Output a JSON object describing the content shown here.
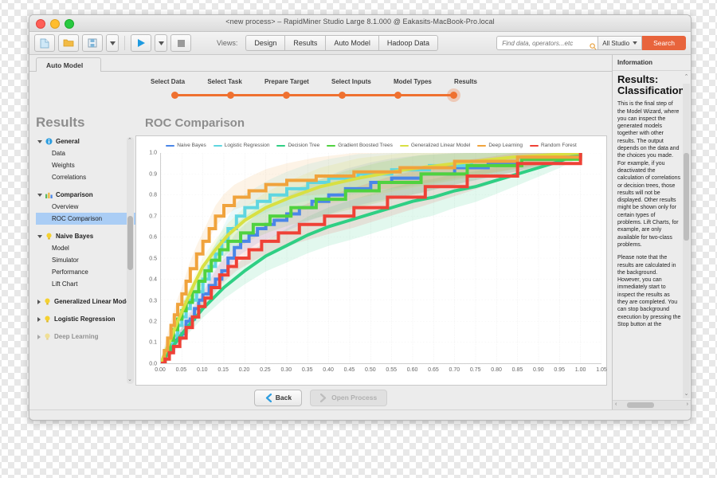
{
  "window": {
    "title": "<new process> – RapidMiner Studio Large 8.1.000 @ Eakasits-MacBook-Pro.local"
  },
  "toolbar": {
    "views_label": "Views:",
    "view_tabs": [
      "Design",
      "Results",
      "Auto Model",
      "Hadoop Data"
    ],
    "search_placeholder": "Find data, operators...etc",
    "search_value": "",
    "scope_selected": "All Studio",
    "search_button": "Search",
    "icons": [
      "new-process-icon",
      "open-folder-icon",
      "save-icon",
      "save-dropdown-icon",
      "run-icon",
      "run-dropdown-icon",
      "stop-icon",
      "search-icon"
    ]
  },
  "app_tab": {
    "label": "Auto Model"
  },
  "wizard": {
    "steps": [
      "Select Data",
      "Select Task",
      "Prepare Target",
      "Select Inputs",
      "Model Types",
      "Results"
    ],
    "active_index": 5,
    "accent": "#ef7130"
  },
  "sidebar": {
    "heading": "Results",
    "nodes": [
      {
        "label": "General",
        "icon": "info-icon",
        "expanded": true,
        "children": [
          "Data",
          "Weights",
          "Correlations"
        ]
      },
      {
        "label": "Comparison",
        "icon": "bars-icon",
        "expanded": true,
        "children": [
          "Overview",
          "ROC Comparison"
        ]
      },
      {
        "label": "Naive Bayes",
        "icon": "bulb-icon",
        "expanded": true,
        "children": [
          "Model",
          "Simulator",
          "Performance",
          "Lift Chart"
        ]
      },
      {
        "label": "Generalized Linear Model",
        "icon": "bulb-icon",
        "expanded": false,
        "children": []
      },
      {
        "label": "Logistic Regression",
        "icon": "bulb-icon",
        "expanded": false,
        "children": []
      },
      {
        "label": "Deep Learning",
        "icon": "bulb-icon",
        "expanded": false,
        "children": []
      }
    ],
    "selected": "ROC Comparison"
  },
  "main": {
    "panel_title": "ROC Comparison",
    "back_button": "Back",
    "open_process_button": "Open Process"
  },
  "info": {
    "header": "Information",
    "title": "Results: Classification",
    "paragraphs": [
      "This is the final step of the Model Wizard, where you can inspect the generated models together with other results. The output depends on the data and the choices you made. For example, if you deactivated the calculation of correlations or decision trees, those results will not be displayed. Other results might be shown only for certain types of problems. Lift Charts, for example, are only available for two-class problems.",
      "Please note that the results are calculated in the background. However, you can immediately start to inspect the results as they are completed. You can stop background execution by pressing the Stop button at the"
    ]
  },
  "chart_data": {
    "type": "line",
    "title": "ROC Comparison",
    "xlabel": "",
    "ylabel": "",
    "xlim": [
      0.0,
      1.05
    ],
    "ylim": [
      0.0,
      1.0
    ],
    "grid": true,
    "legend_position": "top-center",
    "xticks": [
      "0.00",
      "0.05",
      "0.10",
      "0.15",
      "0.20",
      "0.25",
      "0.30",
      "0.35",
      "0.40",
      "0.45",
      "0.50",
      "0.55",
      "0.60",
      "0.65",
      "0.70",
      "0.75",
      "0.80",
      "0.85",
      "0.90",
      "0.95",
      "1.00",
      "1.05"
    ],
    "yticks": [
      "0.0",
      "0.1",
      "0.2",
      "0.3",
      "0.4",
      "0.5",
      "0.6",
      "0.7",
      "0.8",
      "0.9",
      "1.0"
    ],
    "series": [
      {
        "name": "Naive Bayes",
        "color": "#4a86e8",
        "band_color": "rgba(74,134,232,0.13)",
        "points": [
          [
            0,
            0
          ],
          [
            0.01,
            0.04
          ],
          [
            0.02,
            0.06
          ],
          [
            0.03,
            0.11
          ],
          [
            0.04,
            0.12
          ],
          [
            0.05,
            0.14
          ],
          [
            0.06,
            0.2
          ],
          [
            0.07,
            0.21
          ],
          [
            0.08,
            0.26
          ],
          [
            0.09,
            0.3
          ],
          [
            0.1,
            0.33
          ],
          [
            0.115,
            0.37
          ],
          [
            0.13,
            0.4
          ],
          [
            0.145,
            0.44
          ],
          [
            0.16,
            0.5
          ],
          [
            0.175,
            0.55
          ],
          [
            0.19,
            0.58
          ],
          [
            0.21,
            0.61
          ],
          [
            0.23,
            0.64
          ],
          [
            0.25,
            0.66
          ],
          [
            0.27,
            0.68
          ],
          [
            0.3,
            0.71
          ],
          [
            0.33,
            0.74
          ],
          [
            0.36,
            0.77
          ],
          [
            0.4,
            0.8
          ],
          [
            0.44,
            0.83
          ],
          [
            0.5,
            0.86
          ],
          [
            0.55,
            0.88
          ],
          [
            0.62,
            0.9
          ],
          [
            0.7,
            0.93
          ],
          [
            0.78,
            0.95
          ],
          [
            0.86,
            0.97
          ],
          [
            0.93,
            0.99
          ],
          [
            1.0,
            1.0
          ]
        ]
      },
      {
        "name": "Logistic Regression",
        "color": "#5fd6e0",
        "band_color": "rgba(95,214,224,0.13)",
        "points": [
          [
            0,
            0
          ],
          [
            0.01,
            0.05
          ],
          [
            0.02,
            0.09
          ],
          [
            0.03,
            0.13
          ],
          [
            0.04,
            0.18
          ],
          [
            0.05,
            0.22
          ],
          [
            0.06,
            0.26
          ],
          [
            0.07,
            0.3
          ],
          [
            0.085,
            0.34
          ],
          [
            0.1,
            0.4
          ],
          [
            0.115,
            0.46
          ],
          [
            0.13,
            0.52
          ],
          [
            0.145,
            0.58
          ],
          [
            0.16,
            0.64
          ],
          [
            0.18,
            0.7
          ],
          [
            0.2,
            0.74
          ],
          [
            0.23,
            0.77
          ],
          [
            0.26,
            0.8
          ],
          [
            0.3,
            0.83
          ],
          [
            0.35,
            0.86
          ],
          [
            0.4,
            0.88
          ],
          [
            0.47,
            0.9
          ],
          [
            0.55,
            0.92
          ],
          [
            0.64,
            0.94
          ],
          [
            0.74,
            0.96
          ],
          [
            0.85,
            0.98
          ],
          [
            0.95,
            0.99
          ],
          [
            1.0,
            1.0
          ]
        ]
      },
      {
        "name": "Decision Tree",
        "color": "#2fcf84",
        "band_color": "rgba(47,207,132,0.14)",
        "points": [
          [
            0,
            0
          ],
          [
            0.05,
            0.14
          ],
          [
            0.1,
            0.26
          ],
          [
            0.15,
            0.36
          ],
          [
            0.2,
            0.44
          ],
          [
            0.25,
            0.51
          ],
          [
            0.3,
            0.56
          ],
          [
            0.35,
            0.61
          ],
          [
            0.4,
            0.65
          ],
          [
            0.45,
            0.68
          ],
          [
            0.5,
            0.71
          ],
          [
            0.55,
            0.74
          ],
          [
            0.6,
            0.77
          ],
          [
            0.65,
            0.79
          ],
          [
            0.7,
            0.82
          ],
          [
            0.75,
            0.84
          ],
          [
            0.8,
            0.87
          ],
          [
            0.85,
            0.9
          ],
          [
            0.9,
            0.93
          ],
          [
            0.95,
            0.96
          ],
          [
            1.0,
            1.0
          ]
        ]
      },
      {
        "name": "Gradient Boosted Trees",
        "color": "#4fd23f",
        "band_color": "rgba(79,210,63,0.13)",
        "points": [
          [
            0,
            0
          ],
          [
            0.01,
            0.06
          ],
          [
            0.02,
            0.11
          ],
          [
            0.03,
            0.16
          ],
          [
            0.04,
            0.21
          ],
          [
            0.05,
            0.25
          ],
          [
            0.06,
            0.29
          ],
          [
            0.075,
            0.34
          ],
          [
            0.09,
            0.39
          ],
          [
            0.105,
            0.44
          ],
          [
            0.12,
            0.49
          ],
          [
            0.14,
            0.54
          ],
          [
            0.16,
            0.58
          ],
          [
            0.19,
            0.62
          ],
          [
            0.22,
            0.66
          ],
          [
            0.26,
            0.7
          ],
          [
            0.31,
            0.74
          ],
          [
            0.37,
            0.78
          ],
          [
            0.44,
            0.82
          ],
          [
            0.52,
            0.86
          ],
          [
            0.62,
            0.9
          ],
          [
            0.73,
            0.94
          ],
          [
            0.86,
            0.97
          ],
          [
            1.0,
            1.0
          ]
        ]
      },
      {
        "name": "Generalized Linear Model",
        "color": "#d8e043",
        "band_color": "rgba(216,224,67,0.13)",
        "points": [
          [
            0,
            0
          ],
          [
            0.02,
            0.1
          ],
          [
            0.04,
            0.2
          ],
          [
            0.06,
            0.29
          ],
          [
            0.08,
            0.38
          ],
          [
            0.1,
            0.46
          ],
          [
            0.13,
            0.54
          ],
          [
            0.16,
            0.61
          ],
          [
            0.2,
            0.68
          ],
          [
            0.25,
            0.74
          ],
          [
            0.31,
            0.79
          ],
          [
            0.38,
            0.84
          ],
          [
            0.47,
            0.88
          ],
          [
            0.58,
            0.92
          ],
          [
            0.7,
            0.95
          ],
          [
            0.84,
            0.98
          ],
          [
            1.0,
            1.0
          ]
        ]
      },
      {
        "name": "Deep Learning",
        "color": "#f0a33c",
        "band_color": "rgba(240,163,60,0.13)",
        "points": [
          [
            0,
            0
          ],
          [
            0.008,
            0.06
          ],
          [
            0.016,
            0.12
          ],
          [
            0.024,
            0.18
          ],
          [
            0.032,
            0.23
          ],
          [
            0.04,
            0.28
          ],
          [
            0.05,
            0.33
          ],
          [
            0.06,
            0.39
          ],
          [
            0.07,
            0.45
          ],
          [
            0.085,
            0.52
          ],
          [
            0.1,
            0.58
          ],
          [
            0.115,
            0.64
          ],
          [
            0.13,
            0.7
          ],
          [
            0.15,
            0.75
          ],
          [
            0.175,
            0.79
          ],
          [
            0.21,
            0.82
          ],
          [
            0.25,
            0.85
          ],
          [
            0.3,
            0.87
          ],
          [
            0.37,
            0.89
          ],
          [
            0.46,
            0.91
          ],
          [
            0.57,
            0.93
          ],
          [
            0.7,
            0.96
          ],
          [
            0.85,
            0.98
          ],
          [
            1.0,
            1.0
          ]
        ]
      },
      {
        "name": "Random Forest",
        "color": "#ef4136",
        "band_color": "rgba(239,65,54,0.12)",
        "points": [
          [
            0,
            0
          ],
          [
            0.01,
            0.02
          ],
          [
            0.02,
            0.05
          ],
          [
            0.03,
            0.08
          ],
          [
            0.045,
            0.12
          ],
          [
            0.06,
            0.17
          ],
          [
            0.075,
            0.22
          ],
          [
            0.09,
            0.27
          ],
          [
            0.105,
            0.31
          ],
          [
            0.12,
            0.36
          ],
          [
            0.14,
            0.42
          ],
          [
            0.16,
            0.46
          ],
          [
            0.18,
            0.5
          ],
          [
            0.21,
            0.54
          ],
          [
            0.24,
            0.58
          ],
          [
            0.28,
            0.62
          ],
          [
            0.33,
            0.66
          ],
          [
            0.39,
            0.7
          ],
          [
            0.46,
            0.74
          ],
          [
            0.54,
            0.79
          ],
          [
            0.63,
            0.84
          ],
          [
            0.73,
            0.89
          ],
          [
            0.85,
            0.95
          ],
          [
            1.0,
            1.0
          ]
        ]
      }
    ]
  }
}
